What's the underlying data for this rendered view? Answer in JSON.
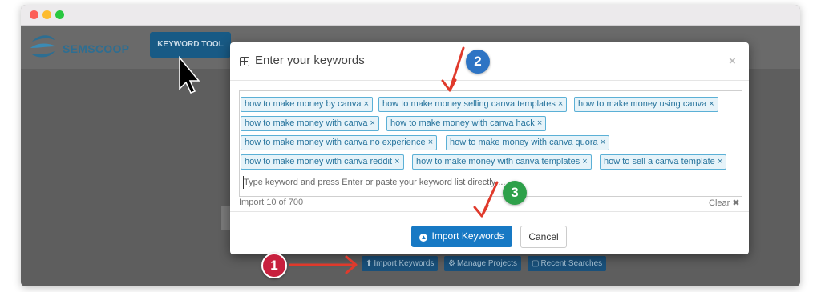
{
  "app": {
    "logo_text": "SEMSCOOP",
    "nav_button": "KEYWORD TOOL"
  },
  "modal": {
    "title": "Enter your keywords",
    "close": "×",
    "keywords": [
      "how to make money by canva",
      "how to make money selling canva templates",
      "how to make money using canva",
      "how to make money with canva",
      "how to make money with canva hack",
      "how to make money with canva no experience",
      "how to make money with canva quora",
      "how to make money with canva reddit",
      "how to make money with canva templates",
      "how to sell a canva template"
    ],
    "chip_remove": "×",
    "input_placeholder": "Type keyword and press Enter or paste your keyword list directly ...",
    "import_count": "Import 10 of 700",
    "clear_label": "Clear ✖",
    "import_button": "Import Keywords",
    "cancel_button": "Cancel"
  },
  "bottom_bar": {
    "import_keywords": "Import Keywords",
    "manage_projects": "Manage Projects",
    "recent_searches": "Recent Searches"
  },
  "annotations": {
    "step1": "1",
    "step2": "2",
    "step3": "3"
  },
  "colors": {
    "primary": "#1779c4",
    "chip_border": "#5bb0d6",
    "arrow": "#e03a2c"
  }
}
